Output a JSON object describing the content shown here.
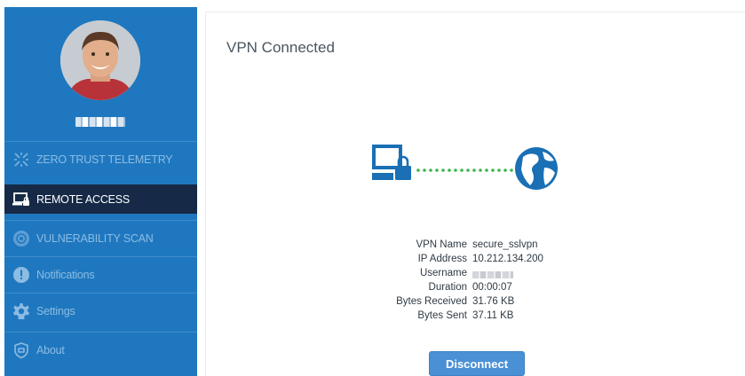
{
  "sidebar": {
    "items": [
      {
        "label": "ZERO TRUST TELEMETRY",
        "icon": "telemetry-icon"
      },
      {
        "label": "REMOTE ACCESS",
        "icon": "remote-access-icon",
        "active": true
      },
      {
        "label": "VULNERABILITY SCAN",
        "icon": "vulnerability-scan-icon"
      },
      {
        "label": "Notifications",
        "icon": "notification-icon"
      },
      {
        "label": "Settings",
        "icon": "gear-icon"
      },
      {
        "label": "About",
        "icon": "about-shield-icon"
      }
    ]
  },
  "main": {
    "title": "VPN Connected",
    "details": [
      {
        "key": "VPN Name",
        "value": "secure_sslvpn"
      },
      {
        "key": "IP Address",
        "value": "10.212.134.200"
      },
      {
        "key": "Username",
        "value": ""
      },
      {
        "key": "Duration",
        "value": "00:00:07"
      },
      {
        "key": "Bytes Received",
        "value": "31.76 KB"
      },
      {
        "key": "Bytes Sent",
        "value": "37.11 KB"
      }
    ],
    "disconnect_label": "Disconnect"
  },
  "colors": {
    "sidebar_bg": "#1f78bf",
    "active_item_bg": "#162a47",
    "connection_dots": "#3bb54a",
    "icon_blue": "#1a6fb5",
    "button_bg": "#4a90d4"
  }
}
